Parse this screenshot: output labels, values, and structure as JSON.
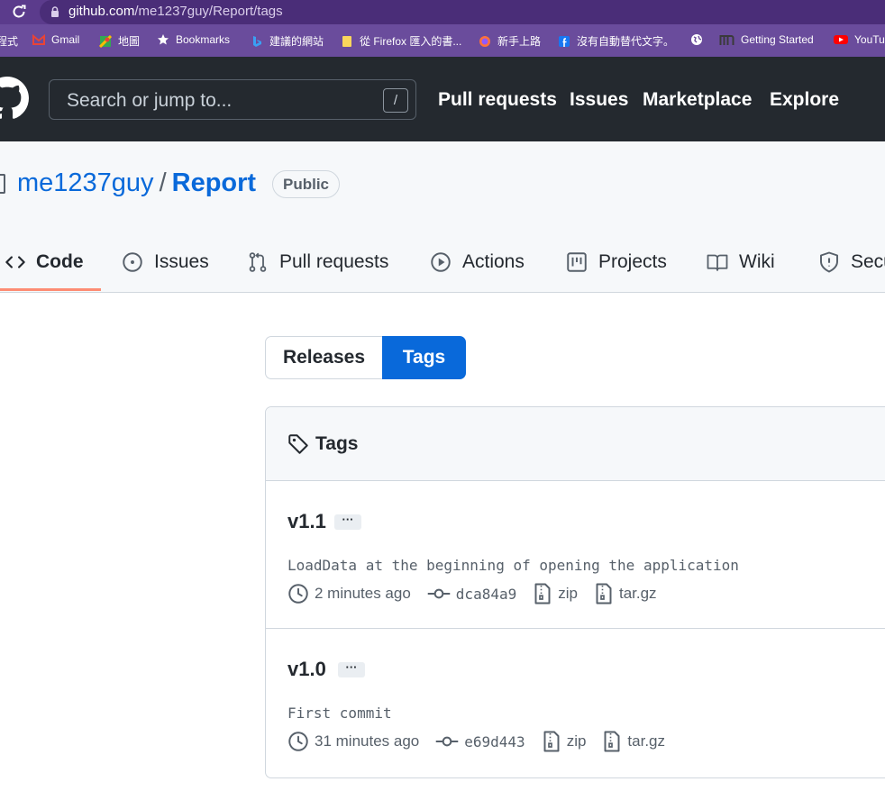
{
  "browser": {
    "url_host": "github.com",
    "url_path": "/me1237guy/Report/tags",
    "bookmarks": [
      {
        "label": "程式",
        "icon": "apps-icon"
      },
      {
        "label": "Gmail",
        "icon": "gmail-icon"
      },
      {
        "label": "地圖",
        "icon": "maps-icon"
      },
      {
        "label": "Bookmarks",
        "icon": "star-icon"
      },
      {
        "label": "建議的網站",
        "icon": "bing-icon"
      },
      {
        "label": "從 Firefox 匯入的書...",
        "icon": "folder-icon"
      },
      {
        "label": "新手上路",
        "icon": "firefox-icon"
      },
      {
        "label": "沒有自動替代文字。",
        "icon": "facebook-icon"
      },
      {
        "label": "",
        "icon": "globe-icon"
      },
      {
        "label": "Getting Started",
        "icon": "m-icon"
      },
      {
        "label": "YouTu",
        "icon": "youtube-icon"
      }
    ]
  },
  "header": {
    "search_placeholder": "Search or jump to...",
    "search_shortcut": "/",
    "nav": [
      "Pull requests",
      "Issues",
      "Marketplace",
      "Explore"
    ]
  },
  "repo": {
    "owner": "me1237guy",
    "separator": "/",
    "name": "Report",
    "visibility": "Public",
    "tabs": [
      {
        "label": "Code",
        "icon": "code-icon",
        "selected": true
      },
      {
        "label": "Issues",
        "icon": "issue-icon"
      },
      {
        "label": "Pull requests",
        "icon": "pull-request-icon"
      },
      {
        "label": "Actions",
        "icon": "play-icon"
      },
      {
        "label": "Projects",
        "icon": "project-icon"
      },
      {
        "label": "Wiki",
        "icon": "book-icon"
      },
      {
        "label": "Secu",
        "icon": "shield-icon"
      }
    ]
  },
  "switch": {
    "releases": "Releases",
    "tags": "Tags",
    "selected": "Tags"
  },
  "tags_box": {
    "title": "Tags",
    "tags": [
      {
        "name": "v1.1",
        "more": "···",
        "message": "LoadData at the beginning of opening the application",
        "time": "2 minutes ago",
        "sha": "dca84a9",
        "zip": "zip",
        "targz": "tar.gz"
      },
      {
        "name": "v1.0",
        "more": "···",
        "message": "First commit",
        "time": "31 minutes ago",
        "sha": "e69d443",
        "zip": "zip",
        "targz": "tar.gz"
      }
    ]
  },
  "colors": {
    "accent": "#0969da",
    "header_bg": "#24292f",
    "tab_underline": "#fd8c73",
    "browser_bar": "#5b3b8c"
  }
}
